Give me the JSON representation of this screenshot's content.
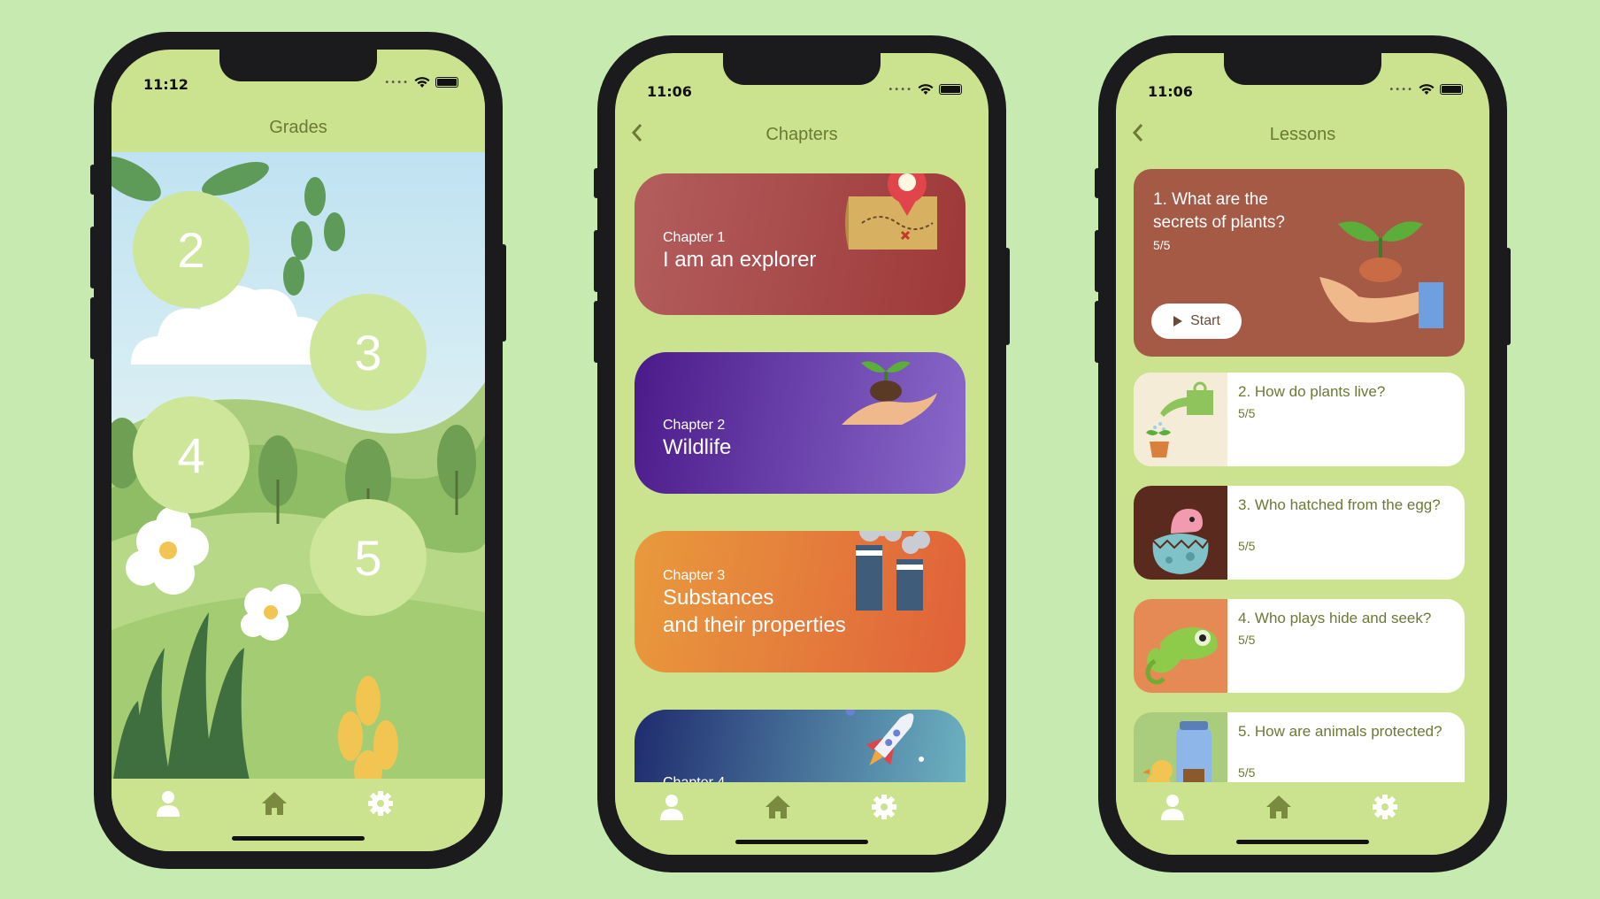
{
  "colors": {
    "background": "#c7eab0",
    "app_green": "#cbe28f",
    "text_olive": "#6b7a35"
  },
  "phone1": {
    "time": "11:12",
    "title": "Grades",
    "grades": [
      "2",
      "3",
      "4",
      "5"
    ]
  },
  "phone2": {
    "time": "11:06",
    "title": "Chapters",
    "back_icon": "chevron-left-icon",
    "chapters": [
      {
        "small": "Chapter 1",
        "big": "I am an explorer"
      },
      {
        "small": "Chapter 2",
        "big": "Wildlife"
      },
      {
        "small": "Chapter 3",
        "big_line1": "Substances",
        "big_line2": "and their properties"
      },
      {
        "small": "Chapter 4"
      }
    ]
  },
  "phone3": {
    "time": "11:06",
    "title": "Lessons",
    "back_icon": "chevron-left-icon",
    "main_lesson": {
      "title": "1. What are the secrets of plants?",
      "progress": "5/5",
      "button": "Start"
    },
    "lessons": [
      {
        "title": "2. How do plants live?",
        "progress": "5/5"
      },
      {
        "title": "3. Who hatched from the egg?",
        "progress": "5/5"
      },
      {
        "title": "4. Who plays hide and seek?",
        "progress": "5/5"
      },
      {
        "title": "5. How are animals protected?",
        "progress": "5/5"
      }
    ]
  },
  "tabbar": {
    "icons": [
      "person-icon",
      "home-icon",
      "gear-icon"
    ]
  }
}
